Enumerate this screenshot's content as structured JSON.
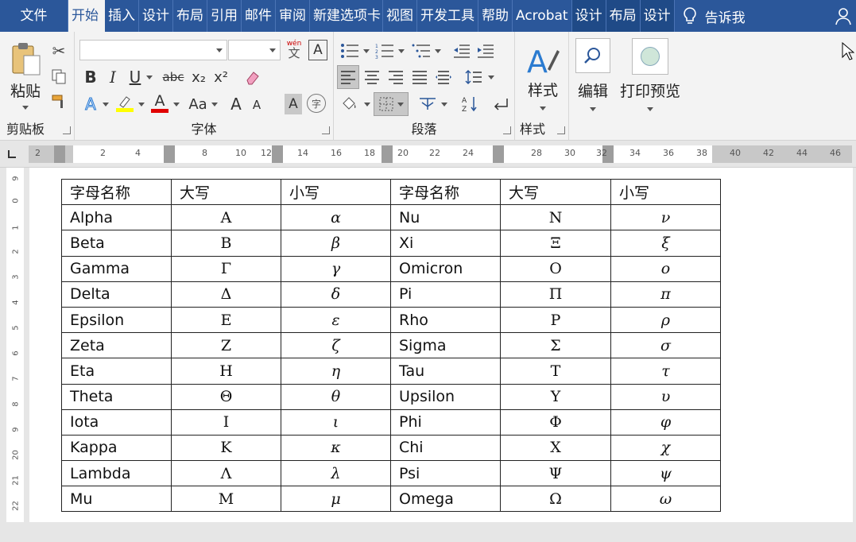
{
  "tabs": [
    "文件",
    "开始",
    "插入",
    "设计",
    "布局",
    "引用",
    "邮件",
    "审阅",
    "新建选项卡",
    "视图",
    "开发工具",
    "帮助",
    "Acrobat",
    "设计",
    "布局",
    "设计"
  ],
  "active_tab": "开始",
  "tell_me": "告诉我",
  "ribbon": {
    "clipboard": {
      "label": "剪贴板",
      "paste": "粘贴"
    },
    "font": {
      "label": "字体",
      "bold": "B",
      "italic": "I",
      "underline": "U",
      "strike": "abc",
      "sub": "x₂",
      "sup": "x²",
      "grow": "A",
      "shrink": "A",
      "aa": "Aa",
      "phonetic_top": "wén",
      "phonetic": "文",
      "border_a": "A",
      "shade_a": "A",
      "circle": "字"
    },
    "paragraph": {
      "label": "段落"
    },
    "styles": {
      "label": "样式",
      "button": "样式"
    },
    "editing": {
      "button": "编辑"
    },
    "print": {
      "button": "打印预览"
    }
  },
  "ruler": {
    "marks": [
      "2",
      "2",
      "4",
      "8",
      "10",
      "12",
      "14",
      "16",
      "18",
      "20",
      "22",
      "24",
      "28",
      "30",
      "32",
      "34",
      "36",
      "38",
      "40",
      "42",
      "44",
      "46"
    ]
  },
  "vruler": {
    "marks": [
      "9",
      "0",
      "1",
      "2",
      "3",
      "4",
      "5",
      "6",
      "7",
      "8",
      "9",
      "20",
      "21",
      "22"
    ]
  },
  "table": {
    "headers": [
      "字母名称",
      "大写",
      "小写",
      "字母名称",
      "大写",
      "小写"
    ],
    "rows": [
      [
        "Alpha",
        "Α",
        "α",
        "Nu",
        "Ν",
        "ν"
      ],
      [
        "Beta",
        "Β",
        "β",
        "Xi",
        "Ξ",
        "ξ"
      ],
      [
        "Gamma",
        "Γ",
        "γ",
        "Omicron",
        "Ο",
        "ο"
      ],
      [
        "Delta",
        "Δ",
        "δ",
        "Pi",
        "Π",
        "π"
      ],
      [
        "Epsilon",
        "Ε",
        "ε",
        "Rho",
        "Ρ",
        "ρ"
      ],
      [
        "Zeta",
        "Ζ",
        "ζ",
        "Sigma",
        "Σ",
        "σ"
      ],
      [
        "Eta",
        "Η",
        "η",
        "Tau",
        "Τ",
        "τ"
      ],
      [
        "Theta",
        "Θ",
        "θ",
        "Upsilon",
        "Υ",
        "υ"
      ],
      [
        "Iota",
        "Ι",
        "ι",
        "Phi",
        "Φ",
        "φ"
      ],
      [
        "Kappa",
        "Κ",
        "κ",
        "Chi",
        "Χ",
        "χ"
      ],
      [
        "Lambda",
        "Λ",
        "λ",
        "Psi",
        "Ψ",
        "ψ"
      ],
      [
        "Mu",
        "Μ",
        "μ",
        "Omega",
        "Ω",
        "ω"
      ]
    ]
  },
  "colors": {
    "accent": "#2b579a",
    "highlight": "#ffff00",
    "font_color": "#e00000"
  }
}
